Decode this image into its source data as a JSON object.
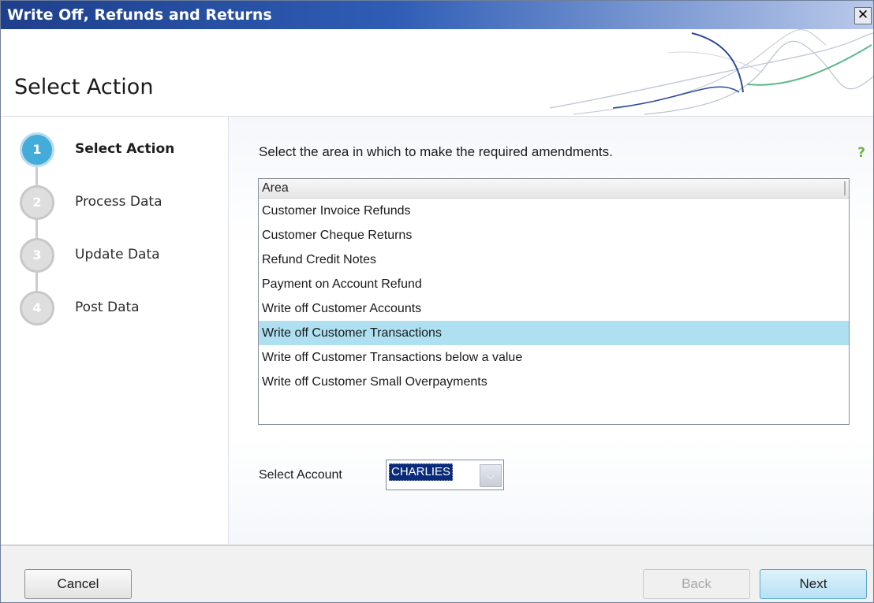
{
  "window": {
    "title": "Write Off, Refunds and Returns",
    "close_glyph": "✕"
  },
  "header": {
    "title": "Select Action"
  },
  "steps": [
    {
      "number": "1",
      "label": "Select Action",
      "active": true
    },
    {
      "number": "2",
      "label": "Process Data",
      "active": false
    },
    {
      "number": "3",
      "label": "Update Data",
      "active": false
    },
    {
      "number": "4",
      "label": "Post Data",
      "active": false
    }
  ],
  "content": {
    "instruction": "Select the area in which to make the required amendments.",
    "help_glyph": "?",
    "list": {
      "header": "Area",
      "items": [
        "Customer Invoice Refunds",
        "Customer Cheque Returns",
        "Refund Credit Notes",
        "Payment on Account Refund",
        "Write off Customer Accounts",
        "Write off Customer Transactions",
        "Write off Customer Transactions below a value",
        "Write off Customer Small Overpayments"
      ],
      "selected_item": "Write off Customer Transactions"
    },
    "account": {
      "label": "Select Account",
      "value": "CHARLIES",
      "dropdown_glyph": "⌵"
    }
  },
  "footer": {
    "cancel_label": "Cancel",
    "back_label": "Back",
    "next_label": "Next",
    "back_enabled": false
  },
  "colors": {
    "titlebar": "#2f5db5",
    "active_step": "#44acd8",
    "selected_row": "#aee0f2",
    "help": "#6cb33f"
  }
}
